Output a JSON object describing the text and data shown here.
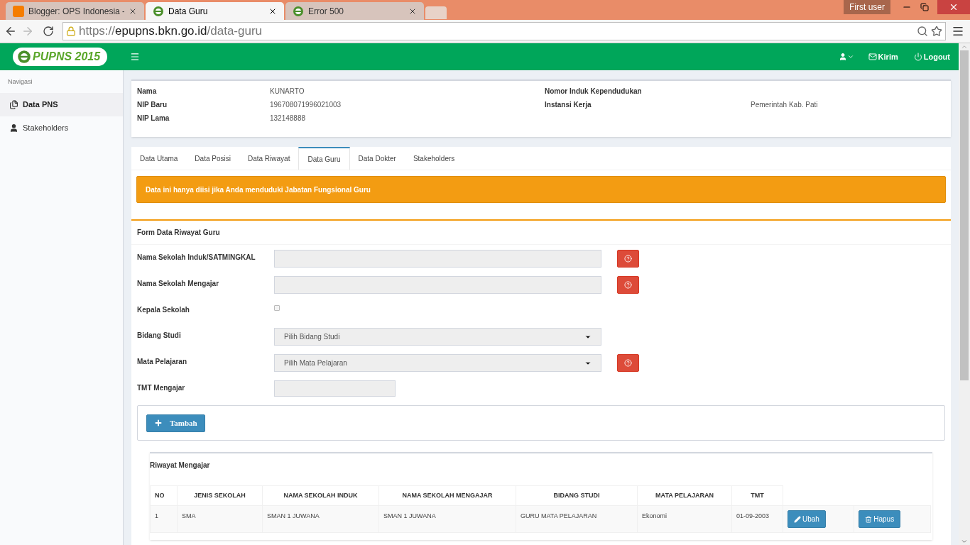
{
  "browser": {
    "tabs": [
      {
        "title": "Blogger: OPS Indonesia - ",
        "kind": "blogger",
        "selected": false
      },
      {
        "title": "Data Guru",
        "kind": "epupns",
        "selected": true
      },
      {
        "title": "Error 500",
        "kind": "epupns",
        "selected": false
      }
    ],
    "user": "First user",
    "url": [
      {
        "text": "https://",
        "strong": false
      },
      {
        "text": "epupns.bkn.go.id",
        "strong": true
      },
      {
        "text": "/data-guru",
        "strong": false
      }
    ]
  },
  "navbar": {
    "logo": "PUPNS 2015",
    "links": [
      {
        "kind": "mail",
        "label": "Kirim"
      },
      {
        "kind": "power",
        "label": "Logout"
      }
    ]
  },
  "sidebar": {
    "heading": "Navigasi",
    "items": [
      {
        "label": "Data PNS",
        "kind": "docs",
        "selected": true
      },
      {
        "label": "Stakeholders",
        "kind": "user",
        "selected": false
      }
    ]
  },
  "profile": {
    "left": [
      {
        "label": "Nama",
        "value": "KUNARTO"
      },
      {
        "label": "NIP Baru",
        "value": "196708071996021003"
      },
      {
        "label": "NIP Lama",
        "value": "132148888"
      }
    ],
    "right": [
      {
        "label": "Nomor Induk Kependudukan"
      },
      {
        "label": "Instansi Kerja",
        "value": "Pemerintah Kab. Pati"
      }
    ]
  },
  "tabs": [
    {
      "label": "Data Utama",
      "selected": false
    },
    {
      "label": "Data Posisi",
      "selected": false
    },
    {
      "label": "Data Riwayat",
      "selected": false
    },
    {
      "label": "Data Guru",
      "selected": true
    },
    {
      "label": "Data Dokter",
      "selected": false
    },
    {
      "label": "Stakeholders",
      "selected": false
    }
  ],
  "alert": "Data ini hanya diisi jika Anda menduduki Jabatan Fungsional Guru",
  "form": {
    "title": "Form Data Riwayat Guru",
    "fields": [
      {
        "kind": "text",
        "label": "Nama Sekolah Induk/SATMINGKAL",
        "help": true
      },
      {
        "kind": "text",
        "label": "Nama Sekolah Mengajar",
        "help": true
      },
      {
        "kind": "checkbox",
        "label": "Kepala Sekolah",
        "checked": false
      },
      {
        "kind": "select",
        "label": "Bidang Studi",
        "placeholder": "Pilih Bidang Studi",
        "help": false
      },
      {
        "kind": "select",
        "label": "Mata Pelajaran",
        "placeholder": "Pilih Mata Pelajaran",
        "help": true
      },
      {
        "kind": "short",
        "label": "TMT Mengajar",
        "help": false
      }
    ],
    "add_button": "Tambah"
  },
  "history": {
    "title": "Riwayat Mengajar",
    "columns": [
      "NO",
      "JENIS SEKOLAH",
      "NAMA SEKOLAH INDUK",
      "NAMA SEKOLAH MENGAJAR",
      "BIDANG STUDI",
      "MATA PELAJARAN",
      "TMT"
    ],
    "rows": [
      {
        "cells": [
          "1",
          "SMA",
          "SMAN 1 JUWANA",
          "SMAN 1 JUWANA",
          "GURU MATA PELAJARAN",
          "Ekonomi",
          "01-09-2003"
        ],
        "edit": "Ubah",
        "delete": "Hapus"
      }
    ]
  }
}
